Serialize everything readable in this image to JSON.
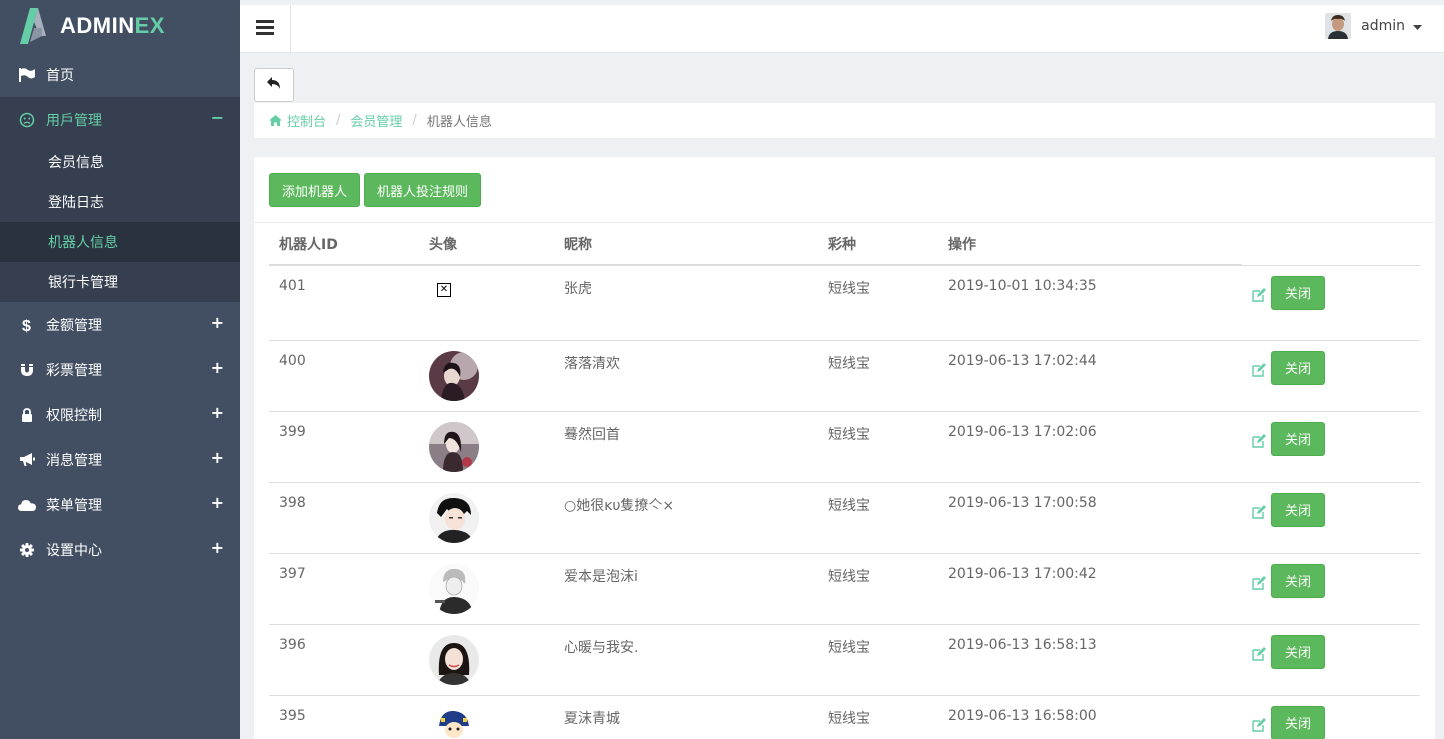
{
  "brand": {
    "name_main": "ADMIN",
    "name_accent": "EX"
  },
  "colors": {
    "accent": "#65cea7",
    "sidebar_bg": "#424f63",
    "success": "#5cb85c"
  },
  "sidebar": {
    "items": [
      {
        "label": "首页",
        "icon": "flag-icon",
        "toggle": ""
      },
      {
        "label": "用戶管理",
        "icon": "frown-icon",
        "toggle": "−",
        "expanded": true,
        "children": [
          {
            "label": "会员信息"
          },
          {
            "label": "登陆日志"
          },
          {
            "label": "机器人信息",
            "current": true
          },
          {
            "label": "银行卡管理"
          }
        ]
      },
      {
        "label": "金额管理",
        "icon": "dollar-icon",
        "toggle": "+"
      },
      {
        "label": "彩票管理",
        "icon": "magnet-icon",
        "toggle": "+"
      },
      {
        "label": "权限控制",
        "icon": "lock-icon",
        "toggle": "+"
      },
      {
        "label": "消息管理",
        "icon": "bullhorn-icon",
        "toggle": "+"
      },
      {
        "label": "菜单管理",
        "icon": "cloud-icon",
        "toggle": "+"
      },
      {
        "label": "设置中心",
        "icon": "gear-icon",
        "toggle": "+"
      }
    ]
  },
  "header": {
    "user_name": "admin"
  },
  "breadcrumb": {
    "home": "控制台",
    "section": "会员管理",
    "current": "机器人信息"
  },
  "toolbar": {
    "add_label": "添加机器人",
    "rules_label": "机器人投注规则"
  },
  "table": {
    "columns": [
      "机器人ID",
      "头像",
      "昵称",
      "彩种",
      "操作",
      ""
    ],
    "close_label": "关闭",
    "rows": [
      {
        "id": "401",
        "avatar": "broken",
        "nickname": "张虎",
        "lottery": "短线宝",
        "time": "2019-10-01 10:34:35"
      },
      {
        "id": "400",
        "avatar": "photo",
        "nickname": "落落清欢",
        "lottery": "短线宝",
        "time": "2019-06-13 17:02:44"
      },
      {
        "id": "399",
        "avatar": "photo",
        "nickname": "蓦然回首",
        "lottery": "短线宝",
        "time": "2019-06-13 17:02:06"
      },
      {
        "id": "398",
        "avatar": "photo",
        "nickname": "○她很ĸυ隻撩亽×",
        "lottery": "短线宝",
        "time": "2019-06-13 17:00:58"
      },
      {
        "id": "397",
        "avatar": "photo",
        "nickname": "爱本是泡沫i",
        "lottery": "短线宝",
        "time": "2019-06-13 17:00:42"
      },
      {
        "id": "396",
        "avatar": "photo",
        "nickname": "心暖与我安.",
        "lottery": "短线宝",
        "time": "2019-06-13 16:58:13"
      },
      {
        "id": "395",
        "avatar": "photo",
        "nickname": "夏沫青城",
        "lottery": "短线宝",
        "time": "2019-06-13 16:58:00"
      }
    ]
  }
}
